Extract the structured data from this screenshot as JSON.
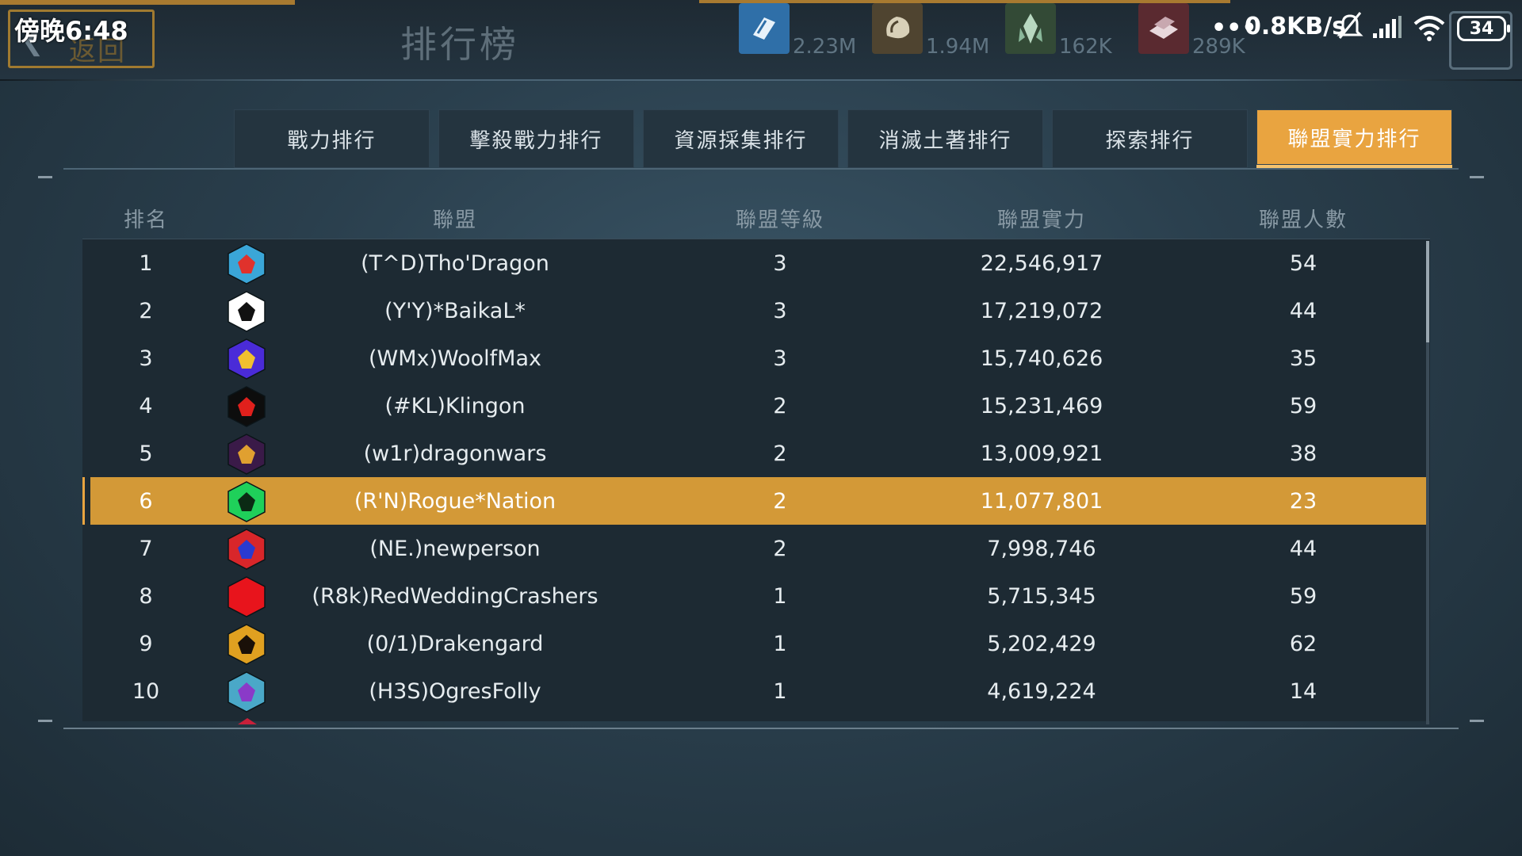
{
  "status_bar": {
    "time": "傍晚6:48",
    "net_speed": "0.8KB/s",
    "battery": "34"
  },
  "header": {
    "back_label": "返回",
    "title": "排行榜"
  },
  "resources": [
    {
      "icon": "metal-resource-icon",
      "value": "2.23M",
      "color": "#2f6fa8"
    },
    {
      "icon": "ore-resource-icon",
      "value": "1.94M",
      "color": "#6a5a3a"
    },
    {
      "icon": "crystal-resource-icon",
      "value": "162K",
      "color": "#3a5a3e"
    },
    {
      "icon": "gold-bars-resource-icon",
      "value": "289K",
      "color": "#7a2c36"
    }
  ],
  "tabs": [
    {
      "label": "戰力排行",
      "active": false
    },
    {
      "label": "擊殺戰力排行",
      "active": false
    },
    {
      "label": "資源採集排行",
      "active": false
    },
    {
      "label": "消滅土著排行",
      "active": false
    },
    {
      "label": "探索排行",
      "active": false
    },
    {
      "label": "聯盟實力排行",
      "active": true
    }
  ],
  "table": {
    "columns": [
      "排名",
      "聯盟",
      "聯盟等級",
      "聯盟實力",
      "聯盟人數"
    ],
    "highlight_rank": "6",
    "rows": [
      {
        "rank": "1",
        "name": "(T^D)Tho'Dragon",
        "level": "3",
        "power": "22,546,917",
        "members": "54",
        "emblem": "blue-star-emblem-icon",
        "emblem_color": "#3aa6d8",
        "emblem_accent": "#e0322c"
      },
      {
        "rank": "2",
        "name": "(Y'Y)*BaikaL*",
        "level": "3",
        "power": "17,219,072",
        "members": "44",
        "emblem": "white-eagle-emblem-icon",
        "emblem_color": "#ffffff",
        "emblem_accent": "#111111"
      },
      {
        "rank": "3",
        "name": "(WMx)WoolfMax",
        "level": "3",
        "power": "15,740,626",
        "members": "35",
        "emblem": "purple-serpent-emblem-icon",
        "emblem_color": "#4a2bd8",
        "emblem_accent": "#f0c030"
      },
      {
        "rank": "4",
        "name": "(#KL)Klingon",
        "level": "2",
        "power": "15,231,469",
        "members": "59",
        "emblem": "black-red-bird-emblem-icon",
        "emblem_color": "#0d0d0d",
        "emblem_accent": "#e0201c"
      },
      {
        "rank": "5",
        "name": "(w1r)dragonwars",
        "level": "2",
        "power": "13,009,921",
        "members": "38",
        "emblem": "dark-winged-emblem-icon",
        "emblem_color": "#3a1a48",
        "emblem_accent": "#e0a030"
      },
      {
        "rank": "6",
        "name": "(R'N)Rogue*Nation",
        "level": "2",
        "power": "11,077,801",
        "members": "23",
        "emblem": "green-helmet-emblem-icon",
        "emblem_color": "#1fd05a",
        "emblem_accent": "#0b2a14"
      },
      {
        "rank": "7",
        "name": "(NE.)newperson",
        "level": "2",
        "power": "7,998,746",
        "members": "44",
        "emblem": "red-blue-orb-emblem-icon",
        "emblem_color": "#d8262a",
        "emblem_accent": "#2a3ad0"
      },
      {
        "rank": "8",
        "name": "(R8k)RedWeddingCrashers",
        "level": "1",
        "power": "5,715,345",
        "members": "59",
        "emblem": "red-plain-emblem-icon",
        "emblem_color": "#e8141c",
        "emblem_accent": "#e8141c"
      },
      {
        "rank": "9",
        "name": "(0/1)Drakengard",
        "level": "1",
        "power": "5,202,429",
        "members": "62",
        "emblem": "gold-dragon-emblem-icon",
        "emblem_color": "#e0a020",
        "emblem_accent": "#1a1008"
      },
      {
        "rank": "10",
        "name": "(H3S)OgresFolly",
        "level": "1",
        "power": "4,619,224",
        "members": "14",
        "emblem": "teal-shield-emblem-icon",
        "emblem_color": "#4aa8c8",
        "emblem_accent": "#8a3ac8"
      }
    ]
  }
}
